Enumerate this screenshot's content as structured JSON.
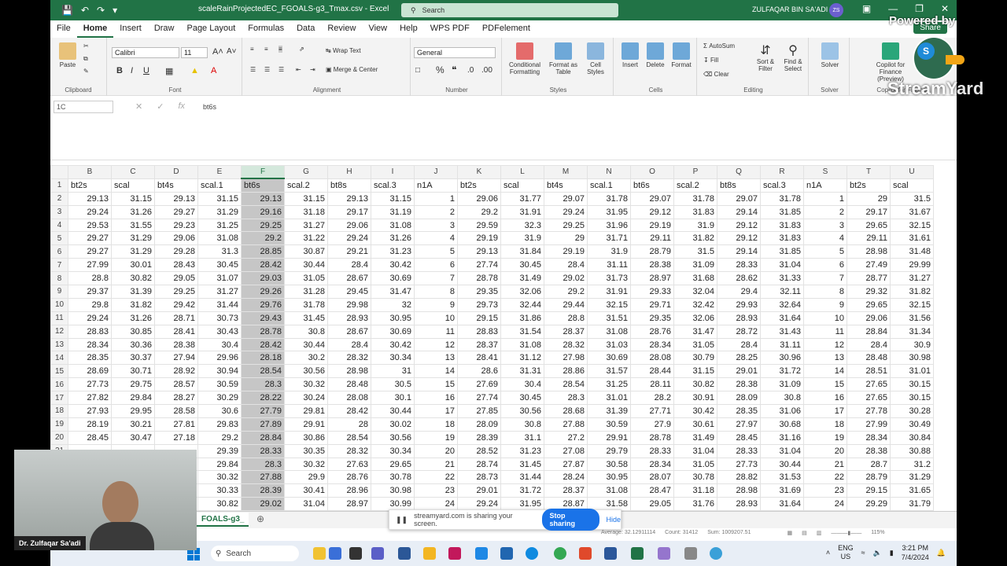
{
  "title": "scaleRainProjectedEC_FGOALS-g3_Tmax.csv  -  Excel",
  "search_label": "Search",
  "user": "ZULFAQAR BIN SA'ADI",
  "avatar_initials": "ZS",
  "menu": [
    "File",
    "Home",
    "Insert",
    "Draw",
    "Page Layout",
    "Formulas",
    "Data",
    "Review",
    "View",
    "Help",
    "WPS PDF",
    "PDFelement"
  ],
  "share": "Share",
  "ribbon": {
    "paste": "Paste",
    "clipboard": "Clipboard",
    "font_name": "Calibri",
    "font_size": "11",
    "font": "Font",
    "wrap": "Wrap Text",
    "merge": "Merge & Center",
    "alignment": "Alignment",
    "numfmt": "General",
    "number": "Number",
    "cond": "Conditional Formatting",
    "fmt_table": "Format as Table",
    "cell_styles": "Cell Styles",
    "styles": "Styles",
    "insert": "Insert",
    "delete": "Delete",
    "format": "Format",
    "cells": "Cells",
    "autosum": "AutoSum",
    "fill": "Fill",
    "clear": "Clear",
    "sort": "Sort & Filter",
    "find": "Find & Select",
    "editing": "Editing",
    "solver": "Solver",
    "solver_grp": "Solver",
    "copilot": "Copilot for Finance (Preview)",
    "copilot_grp": "Copilot for Finance"
  },
  "formula": {
    "namebox": "1C",
    "content": "bt6s"
  },
  "columns": [
    "B",
    "C",
    "D",
    "E",
    "F",
    "G",
    "H",
    "I",
    "J",
    "K",
    "L",
    "M",
    "N",
    "O",
    "P",
    "Q",
    "R",
    "S",
    "T",
    "U"
  ],
  "rows": [
    [
      "1",
      "bt2s",
      "scal",
      "bt4s",
      "scal.1",
      "bt6s",
      "scal.2",
      "bt8s",
      "scal.3",
      "n1A",
      "bt2s",
      "scal",
      "bt4s",
      "scal.1",
      "bt6s",
      "scal.2",
      "bt8s",
      "scal.3",
      "n1A",
      "bt2s",
      "scal"
    ],
    [
      "2",
      "29.13",
      "31.15",
      "29.13",
      "31.15",
      "29.13",
      "31.15",
      "29.13",
      "31.15",
      "1",
      "29.06",
      "31.77",
      "29.07",
      "31.78",
      "29.07",
      "31.78",
      "29.07",
      "31.78",
      "1",
      "29",
      "31.5"
    ],
    [
      "3",
      "29.24",
      "31.26",
      "29.27",
      "31.29",
      "29.16",
      "31.18",
      "29.17",
      "31.19",
      "2",
      "29.2",
      "31.91",
      "29.24",
      "31.95",
      "29.12",
      "31.83",
      "29.14",
      "31.85",
      "2",
      "29.17",
      "31.67"
    ],
    [
      "4",
      "29.53",
      "31.55",
      "29.23",
      "31.25",
      "29.25",
      "31.27",
      "29.06",
      "31.08",
      "3",
      "29.59",
      "32.3",
      "29.25",
      "31.96",
      "29.19",
      "31.9",
      "29.12",
      "31.83",
      "3",
      "29.65",
      "32.15"
    ],
    [
      "5",
      "29.27",
      "31.29",
      "29.06",
      "31.08",
      "29.2",
      "31.22",
      "29.24",
      "31.26",
      "4",
      "29.19",
      "31.9",
      "29",
      "31.71",
      "29.11",
      "31.82",
      "29.12",
      "31.83",
      "4",
      "29.11",
      "31.61"
    ],
    [
      "6",
      "29.27",
      "31.29",
      "29.28",
      "31.3",
      "28.85",
      "30.87",
      "29.21",
      "31.23",
      "5",
      "29.13",
      "31.84",
      "29.19",
      "31.9",
      "28.79",
      "31.5",
      "29.14",
      "31.85",
      "5",
      "28.98",
      "31.48"
    ],
    [
      "7",
      "27.99",
      "30.01",
      "28.43",
      "30.45",
      "28.42",
      "30.44",
      "28.4",
      "30.42",
      "6",
      "27.74",
      "30.45",
      "28.4",
      "31.11",
      "28.38",
      "31.09",
      "28.33",
      "31.04",
      "6",
      "27.49",
      "29.99"
    ],
    [
      "8",
      "28.8",
      "30.82",
      "29.05",
      "31.07",
      "29.03",
      "31.05",
      "28.67",
      "30.69",
      "7",
      "28.78",
      "31.49",
      "29.02",
      "31.73",
      "28.97",
      "31.68",
      "28.62",
      "31.33",
      "7",
      "28.77",
      "31.27"
    ],
    [
      "9",
      "29.37",
      "31.39",
      "29.25",
      "31.27",
      "29.26",
      "31.28",
      "29.45",
      "31.47",
      "8",
      "29.35",
      "32.06",
      "29.2",
      "31.91",
      "29.33",
      "32.04",
      "29.4",
      "32.11",
      "8",
      "29.32",
      "31.82"
    ],
    [
      "10",
      "29.8",
      "31.82",
      "29.42",
      "31.44",
      "29.76",
      "31.78",
      "29.98",
      "32",
      "9",
      "29.73",
      "32.44",
      "29.44",
      "32.15",
      "29.71",
      "32.42",
      "29.93",
      "32.64",
      "9",
      "29.65",
      "32.15"
    ],
    [
      "11",
      "29.24",
      "31.26",
      "28.71",
      "30.73",
      "29.43",
      "31.45",
      "28.93",
      "30.95",
      "10",
      "29.15",
      "31.86",
      "28.8",
      "31.51",
      "29.35",
      "32.06",
      "28.93",
      "31.64",
      "10",
      "29.06",
      "31.56"
    ],
    [
      "12",
      "28.83",
      "30.85",
      "28.41",
      "30.43",
      "28.78",
      "30.8",
      "28.67",
      "30.69",
      "11",
      "28.83",
      "31.54",
      "28.37",
      "31.08",
      "28.76",
      "31.47",
      "28.72",
      "31.43",
      "11",
      "28.84",
      "31.34"
    ],
    [
      "13",
      "28.34",
      "30.36",
      "28.38",
      "30.4",
      "28.42",
      "30.44",
      "28.4",
      "30.42",
      "12",
      "28.37",
      "31.08",
      "28.32",
      "31.03",
      "28.34",
      "31.05",
      "28.4",
      "31.11",
      "12",
      "28.4",
      "30.9"
    ],
    [
      "14",
      "28.35",
      "30.37",
      "27.94",
      "29.96",
      "28.18",
      "30.2",
      "28.32",
      "30.34",
      "13",
      "28.41",
      "31.12",
      "27.98",
      "30.69",
      "28.08",
      "30.79",
      "28.25",
      "30.96",
      "13",
      "28.48",
      "30.98"
    ],
    [
      "15",
      "28.69",
      "30.71",
      "28.92",
      "30.94",
      "28.54",
      "30.56",
      "28.98",
      "31",
      "14",
      "28.6",
      "31.31",
      "28.86",
      "31.57",
      "28.44",
      "31.15",
      "29.01",
      "31.72",
      "14",
      "28.51",
      "31.01"
    ],
    [
      "16",
      "27.73",
      "29.75",
      "28.57",
      "30.59",
      "28.3",
      "30.32",
      "28.48",
      "30.5",
      "15",
      "27.69",
      "30.4",
      "28.54",
      "31.25",
      "28.11",
      "30.82",
      "28.38",
      "31.09",
      "15",
      "27.65",
      "30.15"
    ],
    [
      "17",
      "27.82",
      "29.84",
      "28.27",
      "30.29",
      "28.22",
      "30.24",
      "28.08",
      "30.1",
      "16",
      "27.74",
      "30.45",
      "28.3",
      "31.01",
      "28.2",
      "30.91",
      "28.09",
      "30.8",
      "16",
      "27.65",
      "30.15"
    ],
    [
      "18",
      "27.93",
      "29.95",
      "28.58",
      "30.6",
      "27.79",
      "29.81",
      "28.42",
      "30.44",
      "17",
      "27.85",
      "30.56",
      "28.68",
      "31.39",
      "27.71",
      "30.42",
      "28.35",
      "31.06",
      "17",
      "27.78",
      "30.28"
    ],
    [
      "19",
      "28.19",
      "30.21",
      "27.81",
      "29.83",
      "27.89",
      "29.91",
      "28",
      "30.02",
      "18",
      "28.09",
      "30.8",
      "27.88",
      "30.59",
      "27.9",
      "30.61",
      "27.97",
      "30.68",
      "18",
      "27.99",
      "30.49"
    ],
    [
      "20",
      "28.45",
      "30.47",
      "27.18",
      "29.2",
      "28.84",
      "30.86",
      "28.54",
      "30.56",
      "19",
      "28.39",
      "31.1",
      "27.2",
      "29.91",
      "28.78",
      "31.49",
      "28.45",
      "31.16",
      "19",
      "28.34",
      "30.84"
    ],
    [
      "21",
      "",
      "",
      "",
      "29.39",
      "28.33",
      "30.35",
      "28.32",
      "30.34",
      "20",
      "28.52",
      "31.23",
      "27.08",
      "29.79",
      "28.33",
      "31.04",
      "28.33",
      "31.04",
      "20",
      "28.38",
      "30.88"
    ],
    [
      "22",
      "",
      "",
      "",
      "29.84",
      "28.3",
      "30.32",
      "27.63",
      "29.65",
      "21",
      "28.74",
      "31.45",
      "27.87",
      "30.58",
      "28.34",
      "31.05",
      "27.73",
      "30.44",
      "21",
      "28.7",
      "31.2"
    ],
    [
      "23",
      "",
      "",
      "",
      "30.32",
      "27.88",
      "29.9",
      "28.76",
      "30.78",
      "22",
      "28.73",
      "31.44",
      "28.24",
      "30.95",
      "28.07",
      "30.78",
      "28.82",
      "31.53",
      "22",
      "28.79",
      "31.29"
    ],
    [
      "24",
      "",
      "",
      "",
      "30.33",
      "28.39",
      "30.41",
      "28.96",
      "30.98",
      "23",
      "29.01",
      "31.72",
      "28.37",
      "31.08",
      "28.47",
      "31.18",
      "28.98",
      "31.69",
      "23",
      "29.15",
      "31.65"
    ],
    [
      "25",
      "",
      "",
      "",
      "30.82",
      "29.02",
      "31.04",
      "28.97",
      "30.99",
      "24",
      "29.24",
      "31.95",
      "28.87",
      "31.58",
      "29.05",
      "31.76",
      "28.93",
      "31.64",
      "24",
      "29.29",
      "31.79"
    ]
  ],
  "sheet_tab": "FOALS-g3_",
  "sharing": {
    "text": "streamyard.com is sharing your screen.",
    "stop": "Stop sharing",
    "hide": "Hide"
  },
  "status": {
    "average": "Average: 32.12911114",
    "count": "Count: 31412",
    "sum": "Sum: 1009207.51",
    "zoom": "115%"
  },
  "taskbar": {
    "search": "Search",
    "lang1": "ENG",
    "lang2": "US",
    "time": "3:21 PM",
    "date": "7/4/2024"
  },
  "camera_name": "Dr. Zulfaqar Sa'adi",
  "watermark": {
    "powered": "Powered by",
    "brand": "StreamYard",
    "duck_letter": "S"
  }
}
